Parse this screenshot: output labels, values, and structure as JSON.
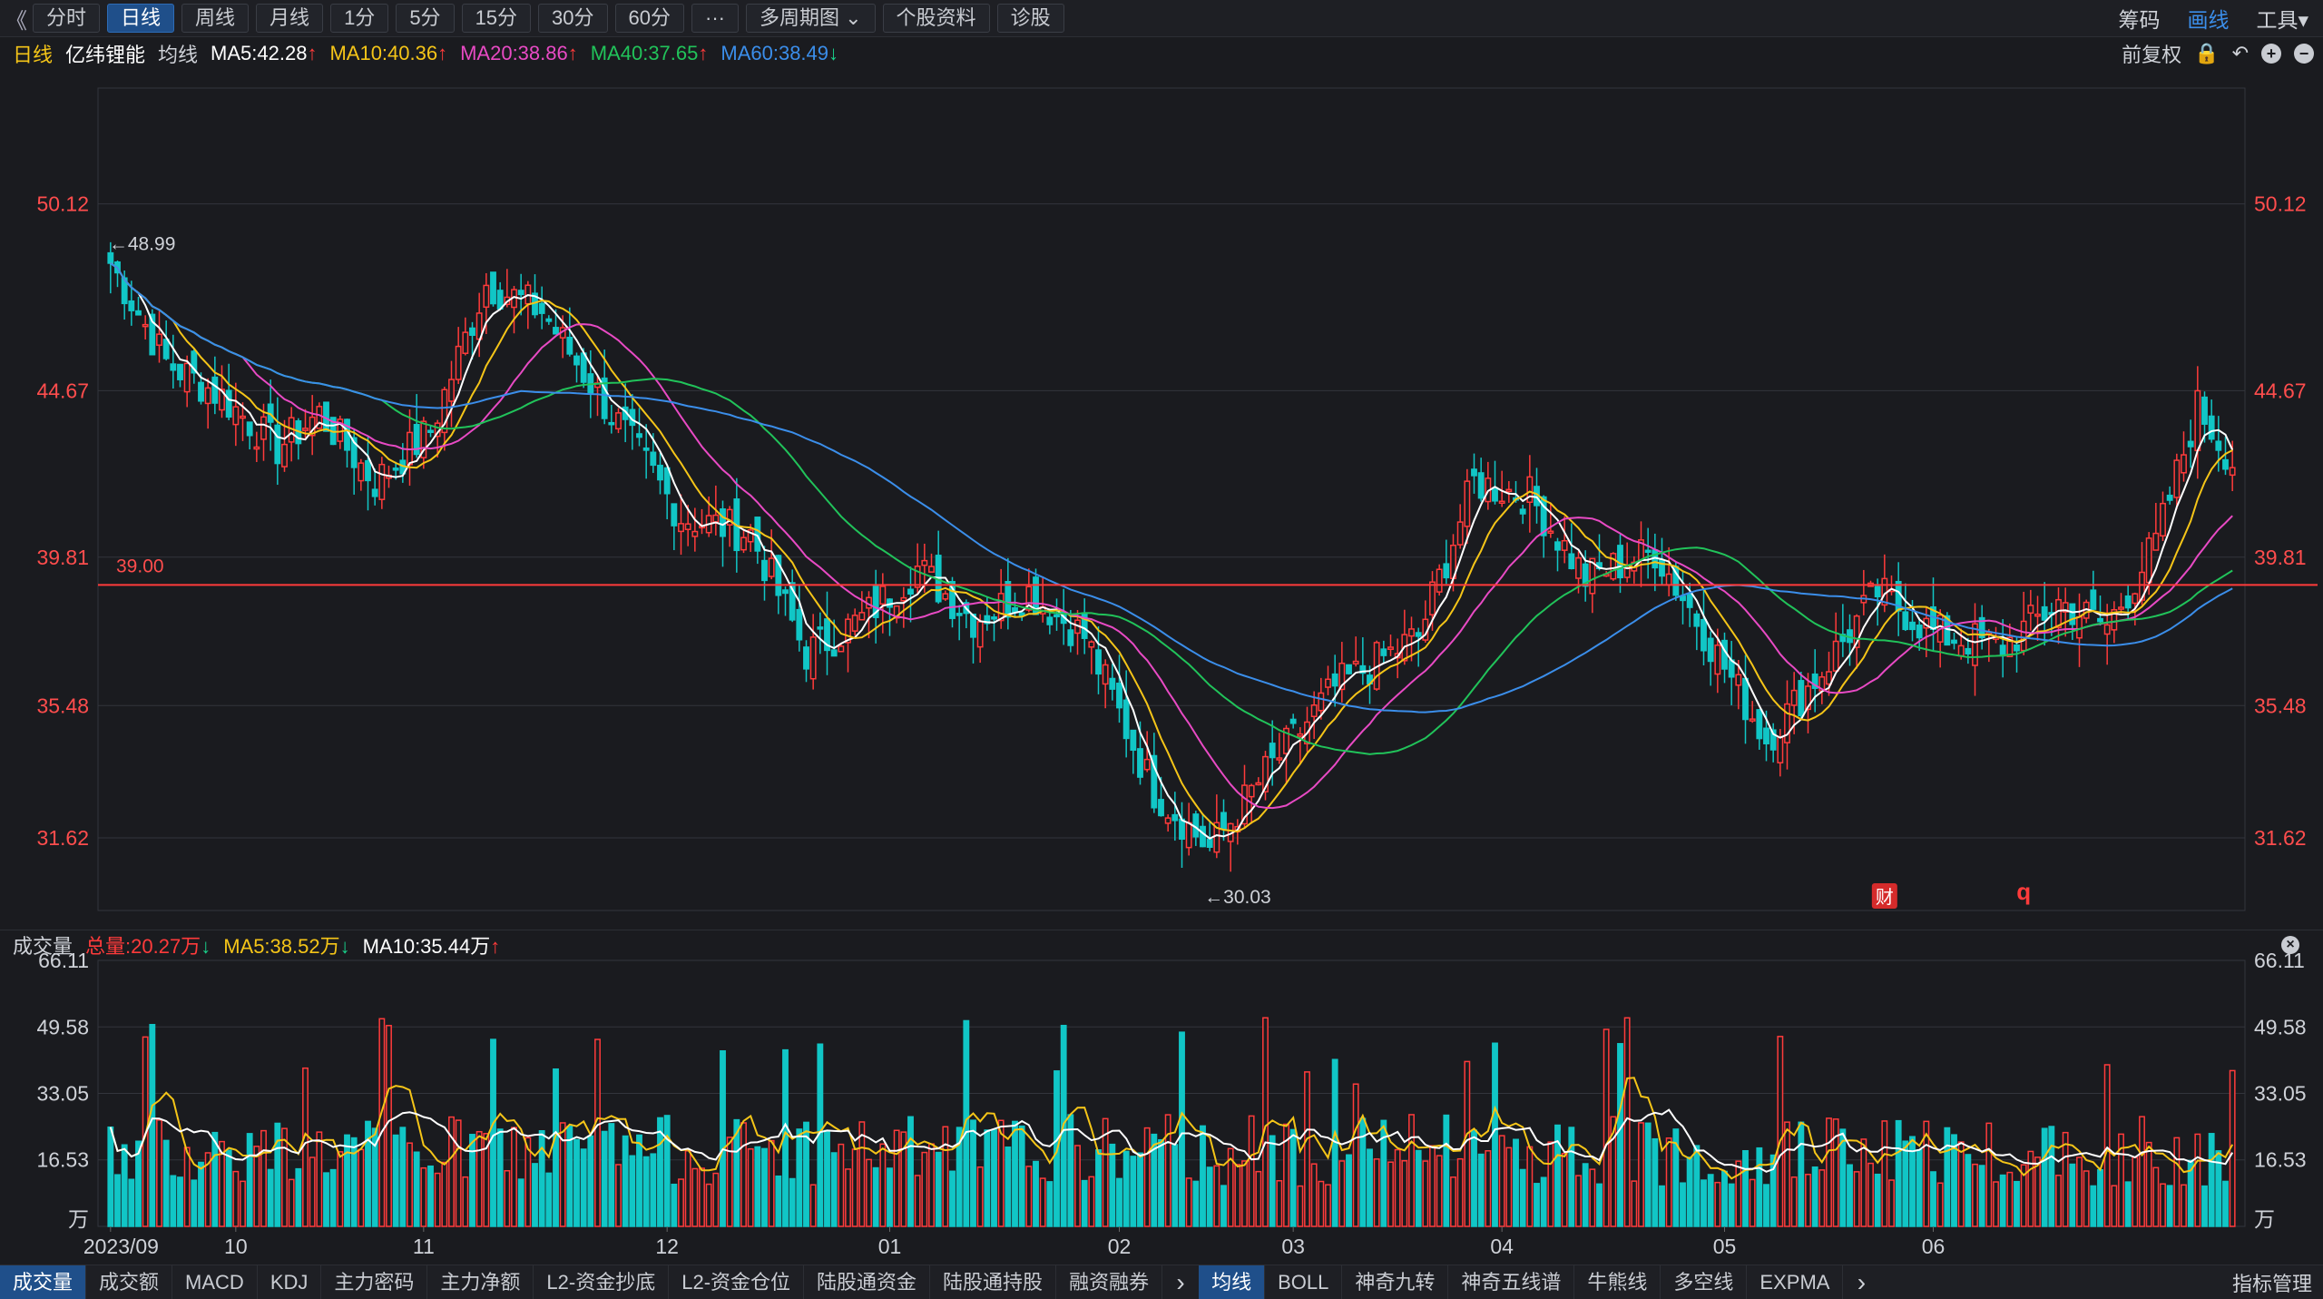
{
  "toolbar": {
    "back": "《",
    "buttons": [
      "分时",
      "日线",
      "周线",
      "月线",
      "1分",
      "5分",
      "15分",
      "30分",
      "60分",
      "···",
      "多周期图 ⌄",
      "个股资料",
      "诊股"
    ],
    "active_index": 1,
    "right": [
      "筹码",
      "画线",
      "工具▾"
    ]
  },
  "info": {
    "period": "日线",
    "stock_name": "亿纬锂能",
    "indicator": "均线",
    "ma5": "MA5:42.28",
    "ma10": "MA10:40.36",
    "ma20": "MA20:38.86",
    "ma40": "MA40:37.65",
    "ma60": "MA60:38.49",
    "ma5_arrow": "↑",
    "ma10_arrow": "↑",
    "ma20_arrow": "↑",
    "ma40_arrow": "↑",
    "ma60_arrow": "↓",
    "fq": "前复权"
  },
  "colors": {
    "up": "#ff3b3b",
    "down": "#11c6c6",
    "ma5": "#ffffff",
    "ma10": "#f5c518",
    "ma20": "#e84ac4",
    "ma40": "#21c35a",
    "ma60": "#3b8eea",
    "grid": "#33353c"
  },
  "price_axis": [
    "50.12",
    "44.67",
    "39.81",
    "35.48",
    "31.62"
  ],
  "annotations": {
    "high": "←48.99",
    "low": "←30.03",
    "hline": "39.00",
    "badge": "财",
    "q": "q"
  },
  "volume": {
    "title": "成交量",
    "total": "总量:20.27万",
    "total_arrow": "↓",
    "ma5": "MA5:38.52万",
    "ma5_arrow": "↓",
    "ma10": "MA10:35.44万",
    "ma10_arrow": "↑",
    "axis": [
      "66.11",
      "49.58",
      "33.05",
      "16.53",
      "万"
    ],
    "close": "×"
  },
  "x_axis": [
    "2023/09",
    "10",
    "11",
    "12",
    "01",
    "02",
    "03",
    "04",
    "05",
    "06"
  ],
  "bottom_tabs_left": [
    "成交量",
    "成交额",
    "MACD",
    "KDJ",
    "主力密码",
    "主力净额",
    "L2-资金抄底",
    "L2-资金仓位",
    "陆股通资金",
    "陆股通持股",
    "融资融券"
  ],
  "bottom_tabs_right": [
    "均线",
    "BOLL",
    "神奇九转",
    "神奇五线谱",
    "牛熊线",
    "多空线",
    "EXPMA"
  ],
  "bottom_more": "›",
  "bottom_manage": "指标管理",
  "chart_data": {
    "type": "candlestick",
    "price_ylim": [
      29.5,
      53.5
    ],
    "volume_ylim": [
      0,
      66.11
    ],
    "anchors_close": [
      [
        0,
        48.4
      ],
      [
        8,
        45.5
      ],
      [
        16,
        44.5
      ],
      [
        24,
        43.0
      ],
      [
        30,
        44.0
      ],
      [
        38,
        42.0
      ],
      [
        46,
        43.5
      ],
      [
        54,
        47.8
      ],
      [
        62,
        47.0
      ],
      [
        72,
        44.0
      ],
      [
        82,
        41.0
      ],
      [
        92,
        40.5
      ],
      [
        100,
        37.0
      ],
      [
        108,
        38.0
      ],
      [
        116,
        39.5
      ],
      [
        124,
        38.0
      ],
      [
        132,
        38.8
      ],
      [
        140,
        37.5
      ],
      [
        150,
        33.0
      ],
      [
        158,
        31.3
      ],
      [
        166,
        33.5
      ],
      [
        176,
        36.0
      ],
      [
        188,
        37.5
      ],
      [
        196,
        42.0
      ],
      [
        204,
        41.6
      ],
      [
        212,
        39.2
      ],
      [
        222,
        40.0
      ],
      [
        228,
        38.0
      ],
      [
        238,
        34.5
      ],
      [
        246,
        36.5
      ],
      [
        254,
        38.8
      ],
      [
        262,
        37.6
      ],
      [
        272,
        37.2
      ],
      [
        280,
        38.5
      ],
      [
        287,
        37.8
      ],
      [
        294,
        40.2
      ],
      [
        300,
        44.2
      ],
      [
        305,
        42.6
      ]
    ],
    "n_candles": 306
  }
}
